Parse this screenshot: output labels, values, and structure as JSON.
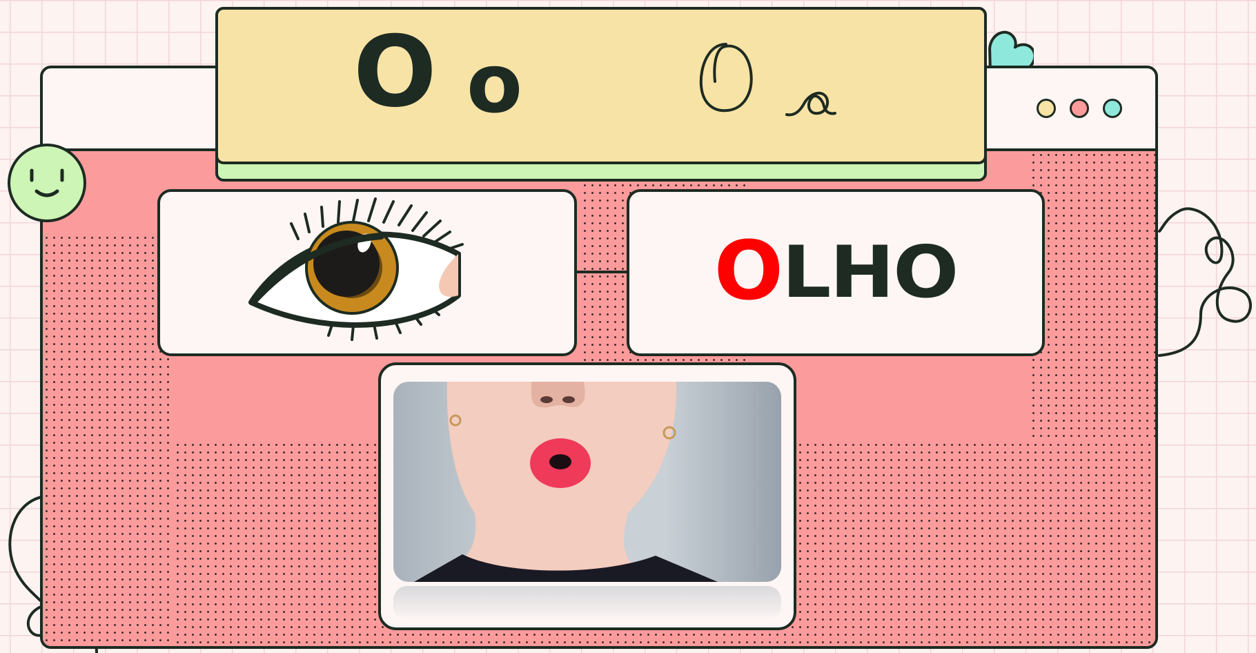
{
  "title_letters": {
    "upper_bold": "O",
    "lower_bold": "o",
    "upper_script": "O",
    "lower_script": "o"
  },
  "word_card": {
    "first_letter": "O",
    "rest": "LHO"
  },
  "colors": {
    "background": "#fdf3f1",
    "window_body": "#fb9b9c",
    "title_card": "#f8e3a6",
    "title_shadow": "#cdf5b5",
    "outline": "#1d2b22",
    "highlight_letter": "#ff0000",
    "window_dots": [
      "#f8e3a6",
      "#fb9b9c",
      "#8fe8dc"
    ],
    "smiley": "#cdf5b5",
    "heart": "#8fe8dc"
  },
  "icons": {
    "window_dots": "traffic-light-dots",
    "eye_picture": "eye-illustration",
    "photo": "mouth-o-shape-photo",
    "smiley": "smiley-face-sticker",
    "heart": "heart-sticker"
  }
}
